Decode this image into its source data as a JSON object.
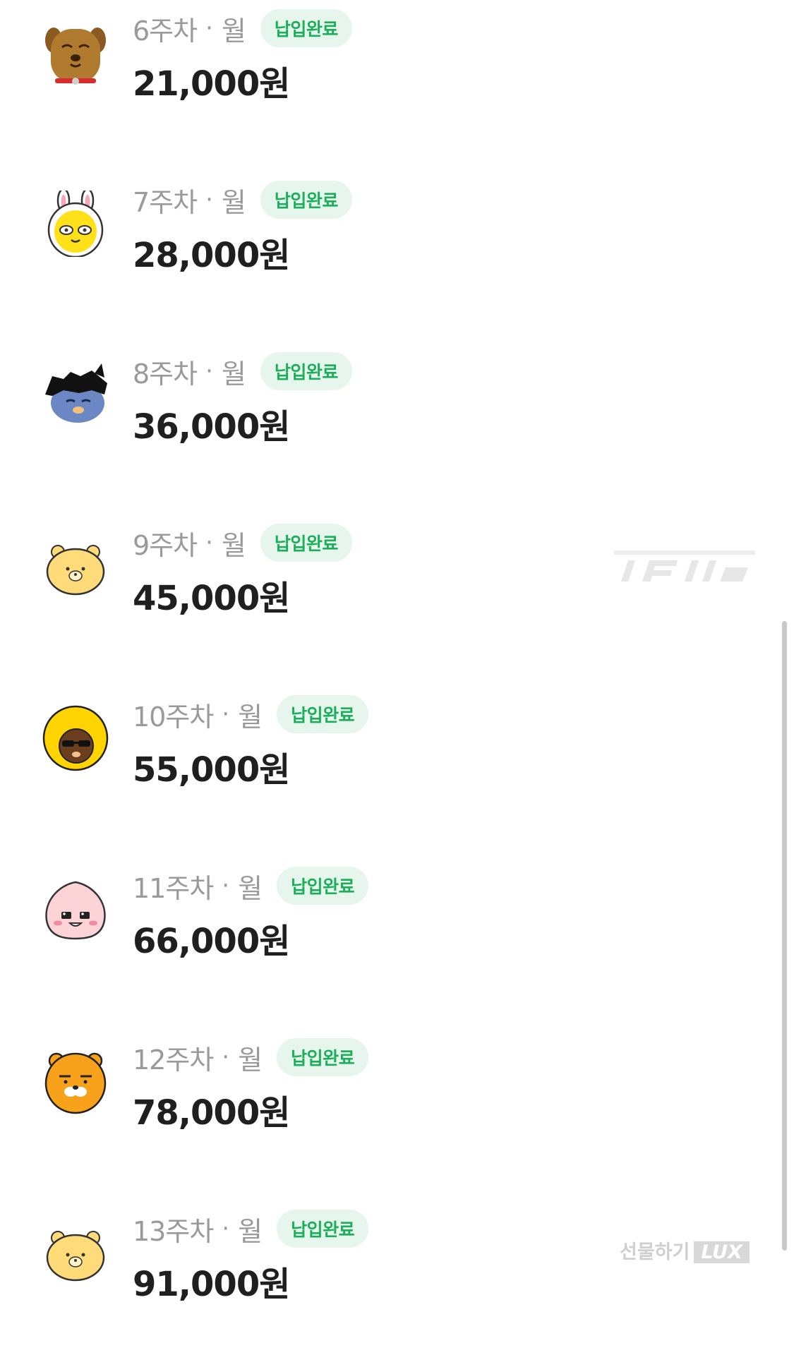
{
  "rows": [
    {
      "week": "6주차",
      "day": "월",
      "badge": "납입완료",
      "amount": "21,000원",
      "avatar": "dog-character-icon"
    },
    {
      "week": "7주차",
      "day": "월",
      "badge": "납입완료",
      "amount": "28,000원",
      "avatar": "rabbit-character-icon"
    },
    {
      "week": "8주차",
      "day": "월",
      "badge": "납입완료",
      "amount": "36,000원",
      "avatar": "cat-character-icon"
    },
    {
      "week": "9주차",
      "day": "월",
      "badge": "납입완료",
      "amount": "45,000원",
      "avatar": "bear-character-icon"
    },
    {
      "week": "10주차",
      "day": "월",
      "badge": "납입완료",
      "amount": "55,000원",
      "avatar": "afro-character-icon"
    },
    {
      "week": "11주차",
      "day": "월",
      "badge": "납입완료",
      "amount": "66,000원",
      "avatar": "peach-character-icon"
    },
    {
      "week": "12주차",
      "day": "월",
      "badge": "납입완료",
      "amount": "78,000원",
      "avatar": "lion-character-icon"
    },
    {
      "week": "13주차",
      "day": "월",
      "badge": "납입완료",
      "amount": "91,000원",
      "avatar": "bear-character-icon"
    }
  ],
  "separator": "·",
  "watermark": {
    "gift": "선물하기",
    "lux": "LUX"
  },
  "colors": {
    "badge_bg": "#e6f6ec",
    "badge_text": "#1cae5b",
    "amount": "#1f1f1f",
    "meta": "#9a9a9a"
  }
}
